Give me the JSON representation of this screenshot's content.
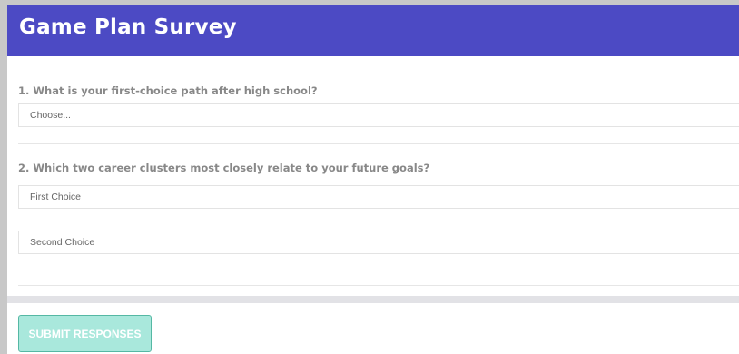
{
  "survey": {
    "title": "Game Plan Survey"
  },
  "questions": [
    {
      "label": "1. What is your first-choice path after high school?",
      "selects": [
        {
          "value": "Choose..."
        }
      ]
    },
    {
      "label": "2. Which two career clusters most closely relate to your future goals?",
      "selects": [
        {
          "value": "First Choice"
        },
        {
          "value": "Second Choice"
        }
      ]
    }
  ],
  "actions": {
    "submit_label": "SUBMIT RESPONSES"
  },
  "colors": {
    "header": "#4c4ac4",
    "submit_bg": "#a9e8dc",
    "submit_border": "#55b8a4"
  }
}
